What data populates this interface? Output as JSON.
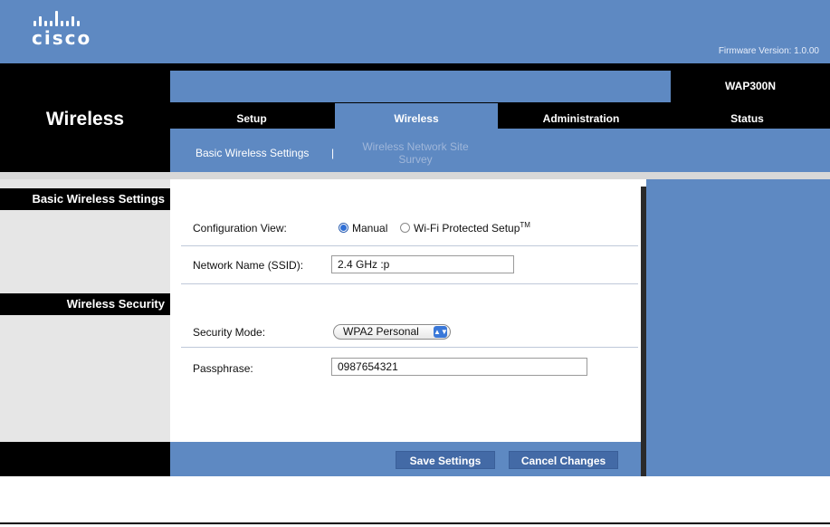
{
  "brand": {
    "logo_text": "cisco",
    "firmware": "Firmware Version: 1.0.00"
  },
  "section_title": "Wireless",
  "model": "WAP300N",
  "tabs": [
    {
      "label": "Setup",
      "active": false
    },
    {
      "label": "Wireless",
      "active": true
    },
    {
      "label": "Administration",
      "active": false
    },
    {
      "label": "Status",
      "active": false
    }
  ],
  "subnav": {
    "basic": "Basic Wireless Settings",
    "separator": "|",
    "site_survey": "Wireless Network Site Survey"
  },
  "sidebar": {
    "basic_heading": "Basic Wireless Settings",
    "security_heading": "Wireless Security"
  },
  "form": {
    "config_view_label": "Configuration View:",
    "manual_label": "Manual",
    "wps_label": "Wi-Fi Protected Setup",
    "wps_sup": "TM",
    "ssid_label": "Network Name (SSID):",
    "ssid_value": "2.4 GHz :p",
    "security_mode_label": "Security Mode:",
    "security_mode_value": "WPA2 Personal",
    "passphrase_label": "Passphrase:",
    "passphrase_value": "0987654321"
  },
  "buttons": {
    "save": "Save Settings",
    "cancel": "Cancel Changes"
  },
  "colors": {
    "brand_blue": "#5e89c2",
    "button_blue": "#436aa6"
  }
}
